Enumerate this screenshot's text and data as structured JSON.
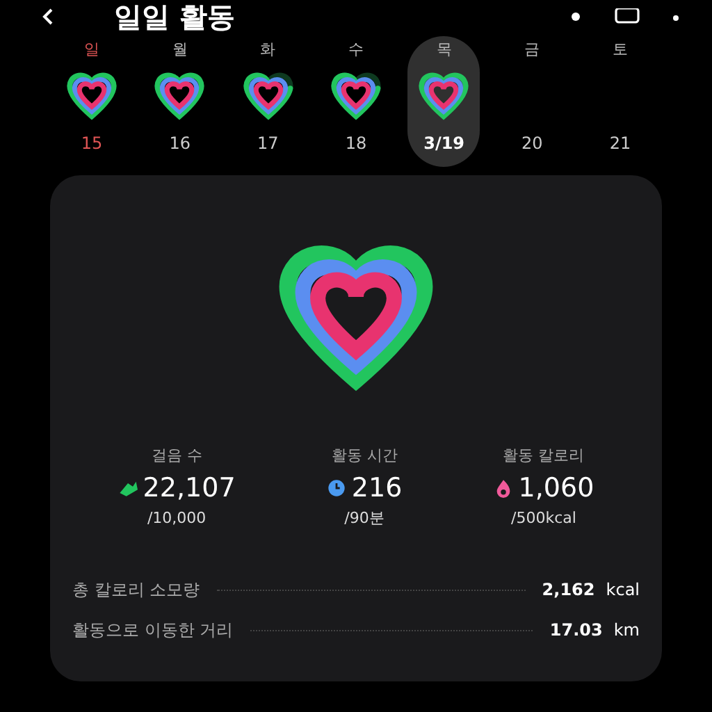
{
  "header": {
    "title": "일일 활동"
  },
  "days": [
    {
      "weekday": "일",
      "date": "15",
      "kind": "sunday",
      "selected": false,
      "has_ring": true,
      "goal_met": true
    },
    {
      "weekday": "월",
      "date": "16",
      "kind": "weekday",
      "selected": false,
      "has_ring": true,
      "goal_met": true
    },
    {
      "weekday": "화",
      "date": "17",
      "kind": "weekday",
      "selected": false,
      "has_ring": true,
      "goal_met": false
    },
    {
      "weekday": "수",
      "date": "18",
      "kind": "weekday",
      "selected": false,
      "has_ring": true,
      "goal_met": false
    },
    {
      "weekday": "목",
      "date": "3/19",
      "kind": "weekday",
      "selected": true,
      "has_ring": true,
      "goal_met": true
    },
    {
      "weekday": "금",
      "date": "20",
      "kind": "weekday",
      "selected": false,
      "has_ring": false
    },
    {
      "weekday": "토",
      "date": "21",
      "kind": "weekday",
      "selected": false,
      "has_ring": false
    }
  ],
  "stats": [
    {
      "label": "걸음 수",
      "kind": "steps",
      "value": "22,107",
      "goal": "/10,000"
    },
    {
      "label": "활동 시간",
      "kind": "time",
      "value": "216",
      "goal": "/90분"
    },
    {
      "label": "활동 칼로리",
      "kind": "calories",
      "value": "1,060",
      "goal": "/500kcal"
    }
  ],
  "details": [
    {
      "label": "총 칼로리 소모량",
      "value": "2,162",
      "unit": "kcal"
    },
    {
      "label": "활동으로 이동한 거리",
      "value": "17.03",
      "unit": "km"
    }
  ]
}
